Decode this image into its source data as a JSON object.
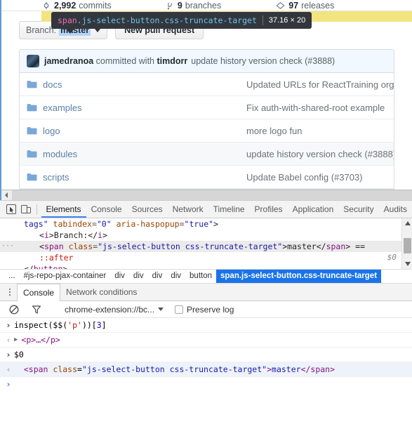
{
  "page": {
    "stats": [
      {
        "icon": "commits-icon",
        "value": "2,992",
        "label": "commits"
      },
      {
        "icon": "branch-icon",
        "value": "9",
        "label": "branches"
      },
      {
        "icon": "tag-icon",
        "value": "97",
        "label": "releases"
      }
    ],
    "inspector_tooltip": {
      "tag": "span",
      "classes": ".js-select-button.css-truncate-target",
      "dimensions": "37.16 × 20",
      "background_color": "#33373d",
      "tag_color": "#f06eb4",
      "class_color": "#6ac5ee"
    },
    "highlight_color": "#f2e47e",
    "toolbar": {
      "branch_label": "Branch:",
      "branch_name": "master",
      "new_pull_request_label": "New pull request"
    },
    "commit_bar": {
      "author": "jamedranoa",
      "committed_with_text": "committed with",
      "co_author": "timdorr",
      "message": "update history version check (#3888)"
    },
    "files": [
      {
        "icon": "folder-icon",
        "name": "docs",
        "message": "Updated URLs for ReactTraining org mo",
        "hovered": false
      },
      {
        "icon": "folder-icon",
        "name": "examples",
        "message": "Fix auth-with-shared-root example",
        "hovered": false
      },
      {
        "icon": "folder-icon",
        "name": "logo",
        "message": "more logo fun",
        "hovered": false
      },
      {
        "icon": "folder-icon",
        "name": "modules",
        "message": "update history version check (#3888)",
        "hovered": true
      },
      {
        "icon": "folder-icon",
        "name": "scripts",
        "message": "Update Babel config (#3703)",
        "hovered": false
      }
    ]
  },
  "devtools": {
    "toolbar_icons": [
      {
        "name": "inspect-element-icon"
      },
      {
        "name": "toggle-device-toolbar-icon"
      }
    ],
    "tabs": [
      {
        "label": "Elements",
        "active": true
      },
      {
        "label": "Console",
        "active": false
      },
      {
        "label": "Sources",
        "active": false
      },
      {
        "label": "Network",
        "active": false
      },
      {
        "label": "Timeline",
        "active": false
      },
      {
        "label": "Profiles",
        "active": false
      },
      {
        "label": "Application",
        "active": false
      },
      {
        "label": "Security",
        "active": false
      },
      {
        "label": "Audits",
        "active": false
      }
    ],
    "active_tab_underline_color": "#4285f4",
    "dom_tree": {
      "line1": {
        "text_a": "tags\" ",
        "attr_b": "tabindex",
        "eq_b": "=",
        "val_b": "\"0\"",
        "attr_c": " aria-haspopup",
        "eq_c": "=",
        "val_c": "\"true\"",
        "close": ">"
      },
      "line2": {
        "open": "<",
        "tag": "i",
        "gt": ">",
        "text": "Branch:",
        "close_open": "</",
        "close_tag": "i",
        "close_gt": ">"
      },
      "line3": {
        "open": "<",
        "tag": "span",
        "attr": " class",
        "eq": "=",
        "val": "\"js-select-button css-truncate-target\"",
        "gt": ">",
        "text": "master",
        "close_open": "</",
        "close_tag": "span",
        "close_gt": ">",
        "trailing": " =="
      },
      "line4": {
        "pseudo": "::after",
        "marker": "$0"
      },
      "line5": {
        "close_open": "</",
        "close_tag": "button",
        "close_gt": ">"
      }
    },
    "breadcrumb": [
      {
        "label": "...",
        "selected": false
      },
      {
        "label": "#js-repo-pjax-container",
        "selected": false
      },
      {
        "label": "div",
        "selected": false
      },
      {
        "label": "div",
        "selected": false
      },
      {
        "label": "div",
        "selected": false
      },
      {
        "label": "div",
        "selected": false
      },
      {
        "label": "button",
        "selected": false
      },
      {
        "label": "span.js-select-button.css-truncate-target",
        "selected": true
      }
    ],
    "breadcrumb_selected_color": "#1a73e8"
  },
  "drawer": {
    "tabs": [
      {
        "label": "Console",
        "active": true
      },
      {
        "label": "Network conditions",
        "active": false
      }
    ],
    "toolbar": {
      "clear_icon": "clear-console-icon",
      "filter_icon": "filter-icon",
      "context": "chrome-extension://bc...caa",
      "preserve_log_label": "Preserve log",
      "preserve_log_checked": false
    },
    "lines": [
      {
        "kind": "input",
        "arrow": "›",
        "parts": [
          {
            "t": "plain",
            "v": "inspect($$("
          },
          {
            "t": "string",
            "v": "'p'"
          },
          {
            "t": "plain",
            "v": "))["
          },
          {
            "t": "number",
            "v": "3"
          },
          {
            "t": "plain",
            "v": "]"
          }
        ]
      },
      {
        "kind": "output",
        "arrow": "‹",
        "disclosure": "▶",
        "parts": [
          {
            "t": "obj",
            "v": "<p>…</p>"
          }
        ]
      },
      {
        "kind": "input",
        "arrow": "›",
        "parts": [
          {
            "t": "plain",
            "v": "$0"
          }
        ]
      },
      {
        "kind": "output",
        "highlighted": true,
        "arrow": "‹",
        "parts": [
          {
            "t": "tag",
            "v": "<span"
          },
          {
            "t": "attr",
            "v": " class"
          },
          {
            "t": "plain",
            "v": "="
          },
          {
            "t": "val",
            "v": "\"js-select-button css-truncate-target\""
          },
          {
            "t": "tag",
            "v": ">"
          },
          {
            "t": "txt",
            "v": "master"
          },
          {
            "t": "tag",
            "v": "</span>"
          }
        ]
      },
      {
        "kind": "prompt",
        "arrow": "›",
        "parts": []
      }
    ]
  }
}
